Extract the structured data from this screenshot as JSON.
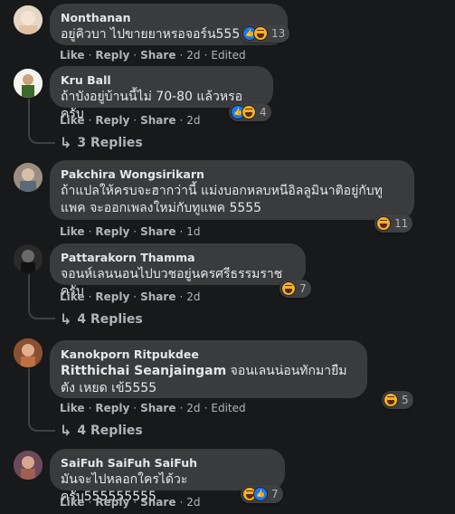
{
  "actions": {
    "like": "Like",
    "reply": "Reply",
    "share": "Share",
    "edited": "Edited"
  },
  "comments": [
    {
      "author": "Nonthanan",
      "text": "อยู่คิวบา ไปขายยาหรอจอร์น555",
      "time": "2d",
      "edited": true,
      "reactions": [
        "like",
        "haha"
      ],
      "count": "13",
      "replies": ""
    },
    {
      "author": "Kru Ball",
      "text": "ถ้าบังอยู่บ้านนี้ไม่ 70-80 แล้วหรอครับ",
      "time": "2d",
      "edited": false,
      "reactions": [
        "like",
        "haha"
      ],
      "count": "4",
      "replies": "3 Replies"
    },
    {
      "author": "Pakchira Wongsirikarn",
      "text": "ถ้าแปลให้ครบจะฮากว่านี้ แม่งบอกหลบหนีอิลลูมินาติอยู่กับทู แพค จะออกเพลงใหม่กับทูแพค 5555",
      "time": "1d",
      "edited": false,
      "reactions": [
        "haha"
      ],
      "count": "11",
      "replies": ""
    },
    {
      "author": "Pattarakorn Thamma",
      "text": "จอนห์เลนนอนไปบวชอยู่นครศรีธรรมราชครับ",
      "time": "2d",
      "edited": false,
      "reactions": [
        "haha"
      ],
      "count": "7",
      "replies": "4 Replies"
    },
    {
      "author": "Kanokporn Ritpukdee",
      "mention": "Ritthichai Seanjaingam",
      "text": " จอนเลนน่อนทักมายืมตัง เหยด เข้5555",
      "time": "2d",
      "edited": true,
      "reactions": [
        "haha"
      ],
      "count": "5",
      "replies": "4 Replies"
    },
    {
      "author": "SaiFuh SaiFuh SaiFuh",
      "text": "มันจะไปหลอกใครได้วะครับ555555555",
      "time": "2d",
      "edited": false,
      "reactions": [
        "haha",
        "like"
      ],
      "count": "7",
      "replies": ""
    }
  ],
  "colors": {
    "background": "#18191a",
    "bubble": "#3a3b3c",
    "secondary_text": "#b0b3b8",
    "like_blue": "#1877f2",
    "haha_yellow": "#f7b125"
  }
}
